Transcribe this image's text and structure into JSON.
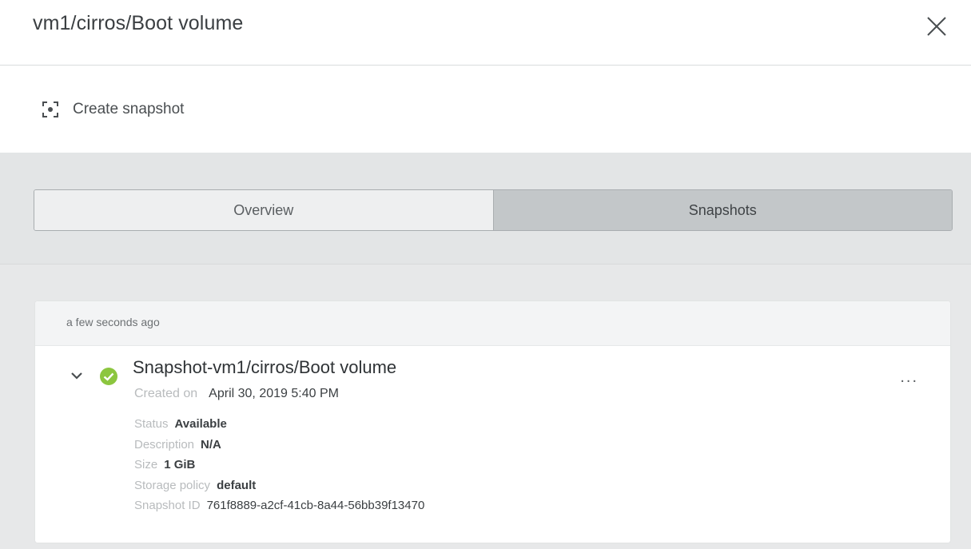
{
  "header": {
    "title": "vm1/cirros/Boot volume"
  },
  "toolbar": {
    "create_snapshot_label": "Create snapshot"
  },
  "tabs": [
    {
      "label": "Overview",
      "active": false
    },
    {
      "label": "Snapshots",
      "active": true
    }
  ],
  "snapshot_group": {
    "time_label": "a few seconds ago",
    "item": {
      "name": "Snapshot-vm1/cirros/Boot volume",
      "status_color": "#8cc63f",
      "created_label": "Created on",
      "created_value": "April 30, 2019 5:40 PM",
      "details": [
        {
          "label": "Status",
          "value": "Available"
        },
        {
          "label": "Description",
          "value": "N/A"
        },
        {
          "label": "Size",
          "value": "1 GiB"
        },
        {
          "label": "Storage policy",
          "value": "default"
        },
        {
          "label": "Snapshot ID",
          "value": "761f8889-a2cf-41cb-8a44-56bb39f13470"
        }
      ],
      "menu_label": "..."
    }
  },
  "icons": {
    "close": "close-icon",
    "create_snapshot": "camera-focus-icon",
    "expand": "chevron-down-icon",
    "status": "check-circle-icon",
    "menu": "more-horizontal-icon"
  }
}
